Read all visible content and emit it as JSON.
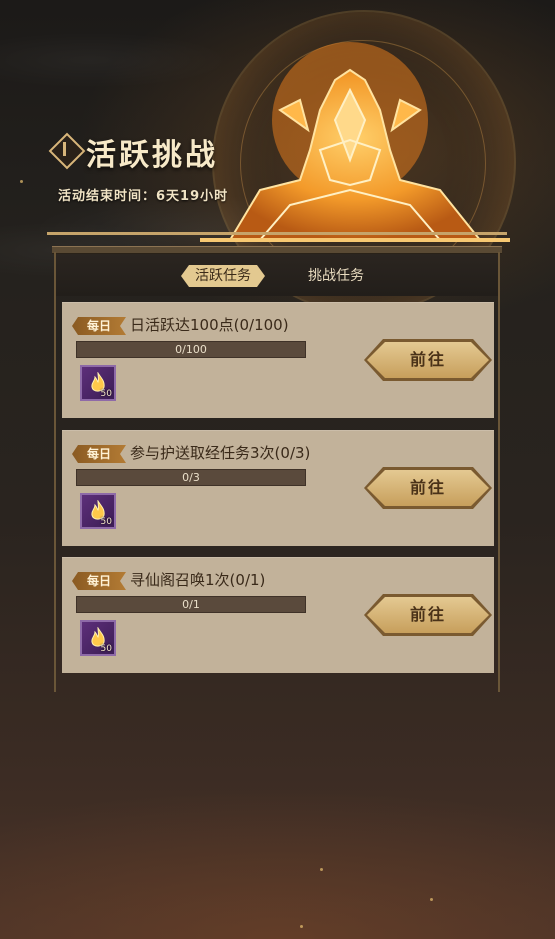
{
  "header": {
    "title": "活跃挑战",
    "end_time_label": "活动结束时间：6天19小时"
  },
  "tabs": [
    {
      "label": "活跃任务",
      "active": true
    },
    {
      "label": "挑战任务",
      "active": false
    }
  ],
  "tasks": [
    {
      "badge": "每日",
      "text": "日活跃达100点(0/100)",
      "progress_text": "0/100",
      "progress": 0,
      "reward_icon": "flame-icon",
      "reward_count": "50",
      "button": "前往"
    },
    {
      "badge": "每日",
      "text": "参与护送取经任务3次(0/3)",
      "progress_text": "0/3",
      "progress": 0,
      "reward_icon": "flame-icon",
      "reward_count": "50",
      "button": "前往"
    },
    {
      "badge": "每日",
      "text": "寻仙阁召唤1次(0/1)",
      "progress_text": "0/1",
      "progress": 0,
      "reward_icon": "flame-icon",
      "reward_count": "50",
      "button": "前往"
    }
  ],
  "colors": {
    "accent_gold": "#e3c990",
    "card_bg": "#c2b29a",
    "reward_bg": "#5d2f7a"
  }
}
